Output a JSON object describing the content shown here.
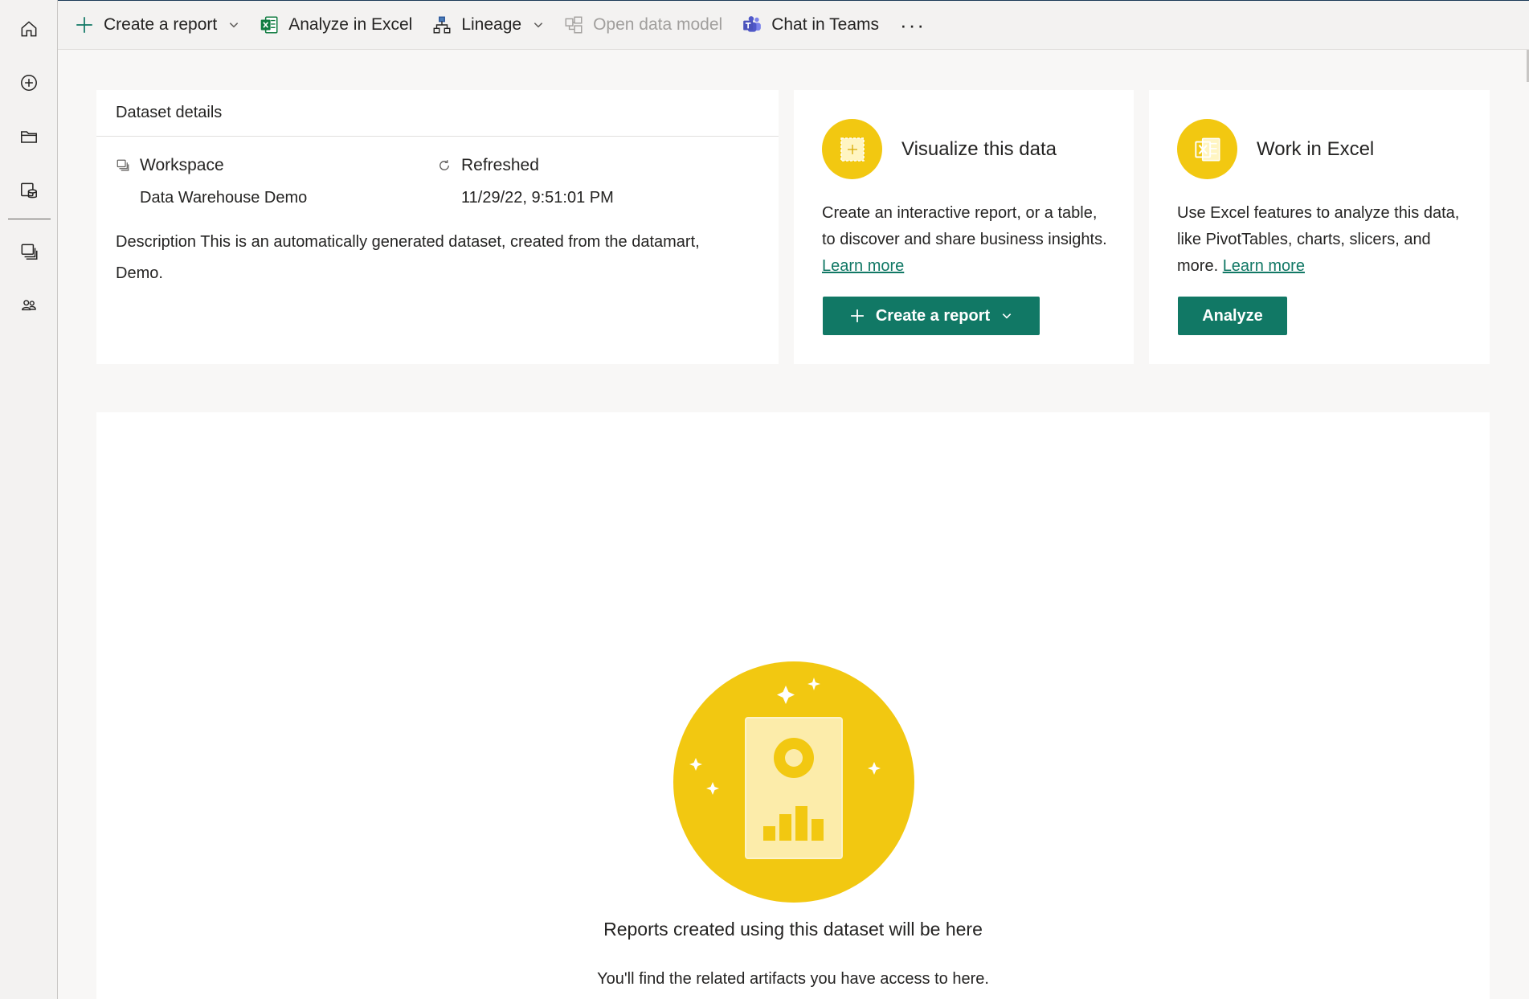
{
  "toolbar": {
    "create_report": "Create a report",
    "analyze_excel": "Analyze in Excel",
    "lineage": "Lineage",
    "open_data_model": "Open data model",
    "chat_teams": "Chat in Teams",
    "more": "···"
  },
  "details": {
    "title": "Dataset details",
    "workspace_label": "Workspace",
    "workspace_value": "Data Warehouse Demo",
    "refreshed_label": "Refreshed",
    "refreshed_value": "11/29/22, 9:51:01 PM",
    "description_label": "Description",
    "description_text": " This is an automatically generated dataset, created from the datamart, Demo."
  },
  "visualize": {
    "title": "Visualize this data",
    "text": "Create an interactive report, or a table, to discover and share business insights. ",
    "link": "Learn more",
    "button": "Create a report"
  },
  "excel": {
    "title": "Work in Excel",
    "text": "Use Excel features to analyze this data, like PivotTables, charts, slicers, and more. ",
    "link": "Learn more",
    "button": "Analyze"
  },
  "related": {
    "empty_title": "Reports created using this dataset will be here",
    "empty_sub": "You'll find the related artifacts you have access to here."
  },
  "colors": {
    "accent": "#117865",
    "brand_yellow": "#f2c811"
  },
  "icons": {
    "rail": [
      "home-icon",
      "create-icon",
      "browse-icon",
      "data-hub-icon",
      "workspaces-icon",
      "people-icon"
    ]
  }
}
